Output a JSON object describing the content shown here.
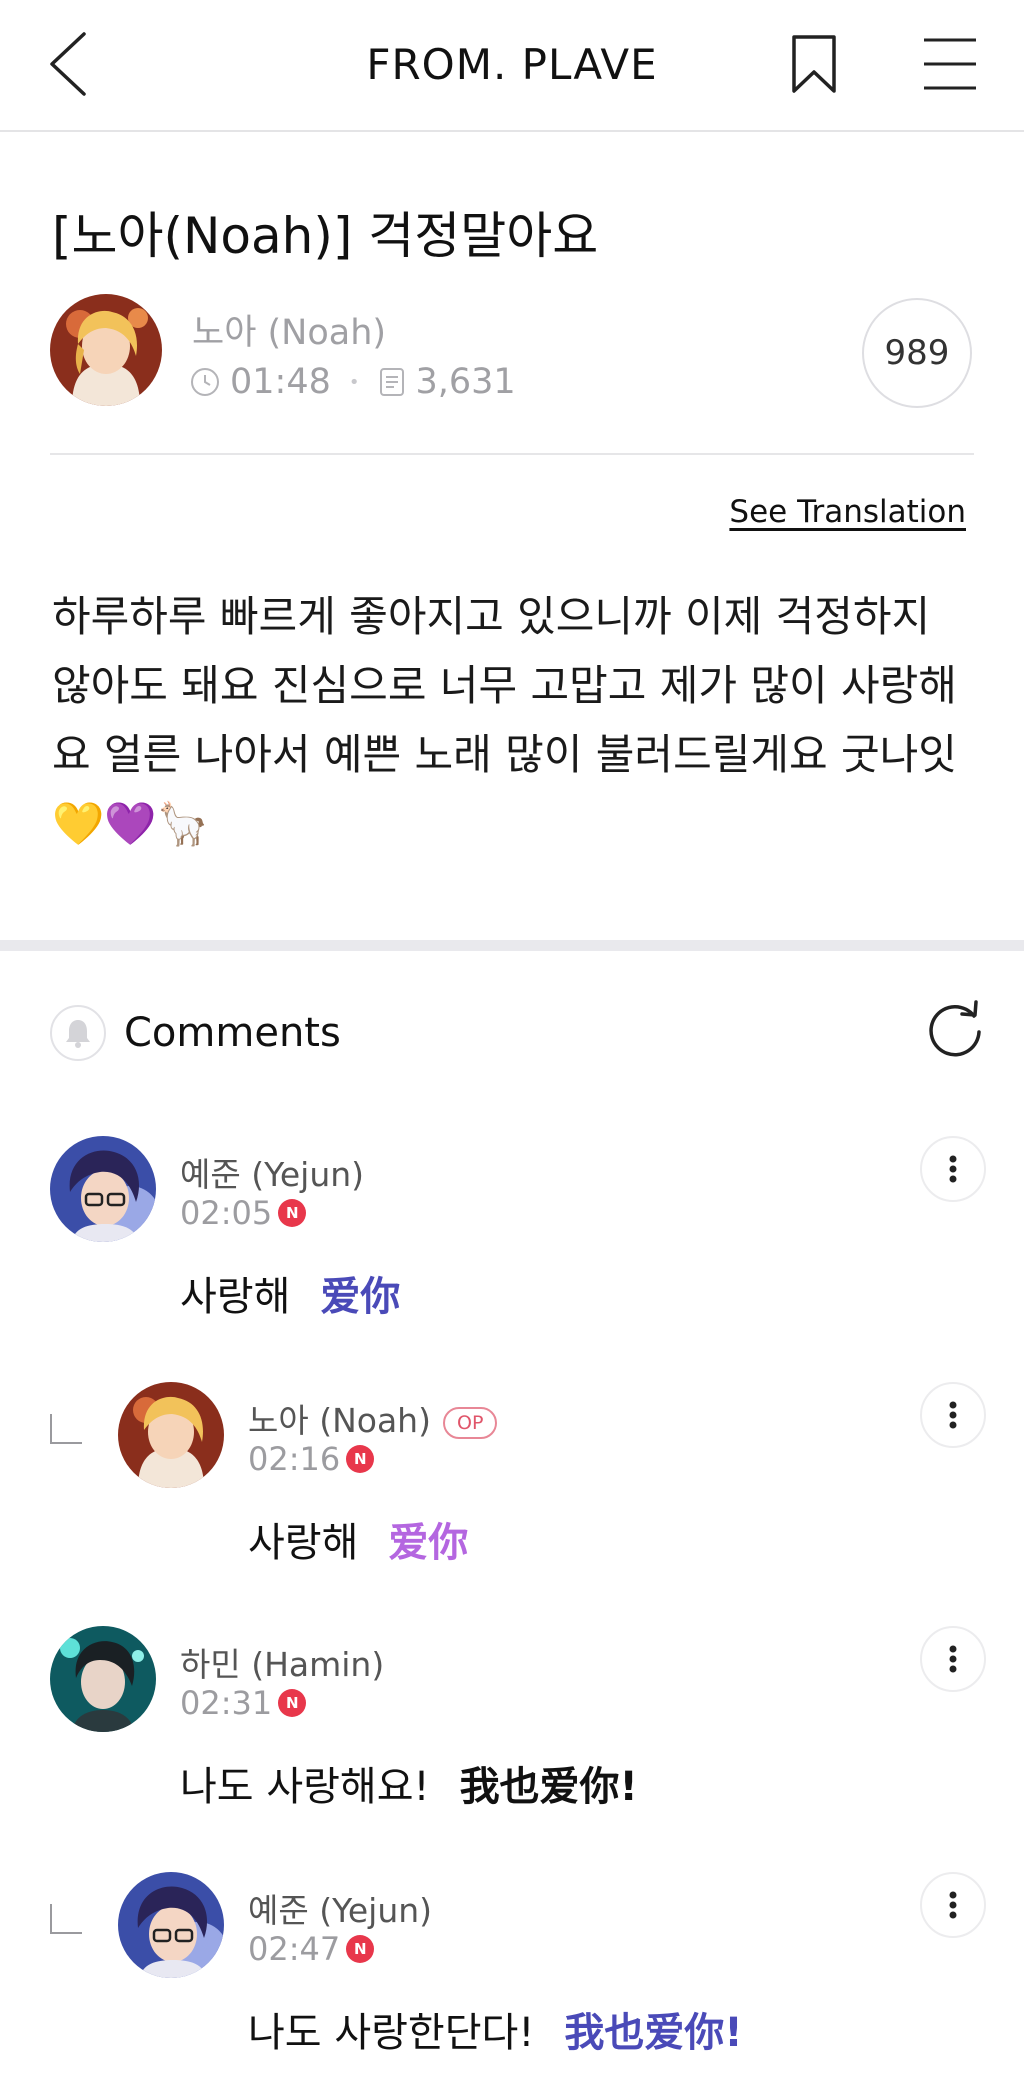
{
  "header": {
    "title": "FROM. PLAVE"
  },
  "post": {
    "title": "[노아(Noah)] 걱정말아요",
    "author": "노아 (Noah)",
    "time": "01:48",
    "views": "3,631",
    "likes": "989",
    "see_translation": "See Translation",
    "body": "하루하루 빠르게 좋아지고 있으니까 이제 걱정하지 않아도 돼요 진심으로 너무 고맙고 제가 많이 사랑해요 얼른 나아서 예쁜 노래 많이 불러드릴게요 굿나잇💛💜🦙"
  },
  "comments_section": {
    "label": "Comments"
  },
  "comments": [
    {
      "name": "예준 (Yejun)",
      "time": "02:05",
      "badge": "N",
      "text": "사랑해",
      "translation": "爱你",
      "translation_color": "#4a4ab8"
    },
    {
      "name": "노아 (Noah)",
      "op": "OP",
      "time": "02:16",
      "badge": "N",
      "text": "사랑해",
      "translation": "爱你",
      "translation_color": "#b466e0"
    },
    {
      "name": "하민 (Hamin)",
      "time": "02:31",
      "badge": "N",
      "text": "나도 사랑해요!",
      "translation": "我也爱你!",
      "translation_color": "#111111"
    },
    {
      "name": "예준 (Yejun)",
      "time": "02:47",
      "badge": "N",
      "text": "나도 사랑한단다!",
      "translation": "我也爱你!",
      "translation_color": "#4a4ab8"
    }
  ],
  "icons": {
    "back": "chevron-left-icon",
    "bookmark": "bookmark-icon",
    "menu": "hamburger-menu-icon",
    "clock": "clock-icon",
    "views": "document-icon",
    "bell": "bell-icon",
    "refresh": "refresh-icon",
    "more": "vertical-dots-icon"
  },
  "colors": {
    "new_badge": "#e8374b",
    "op_badge": "#e0556a",
    "section_gap": "#e9e9ed"
  }
}
